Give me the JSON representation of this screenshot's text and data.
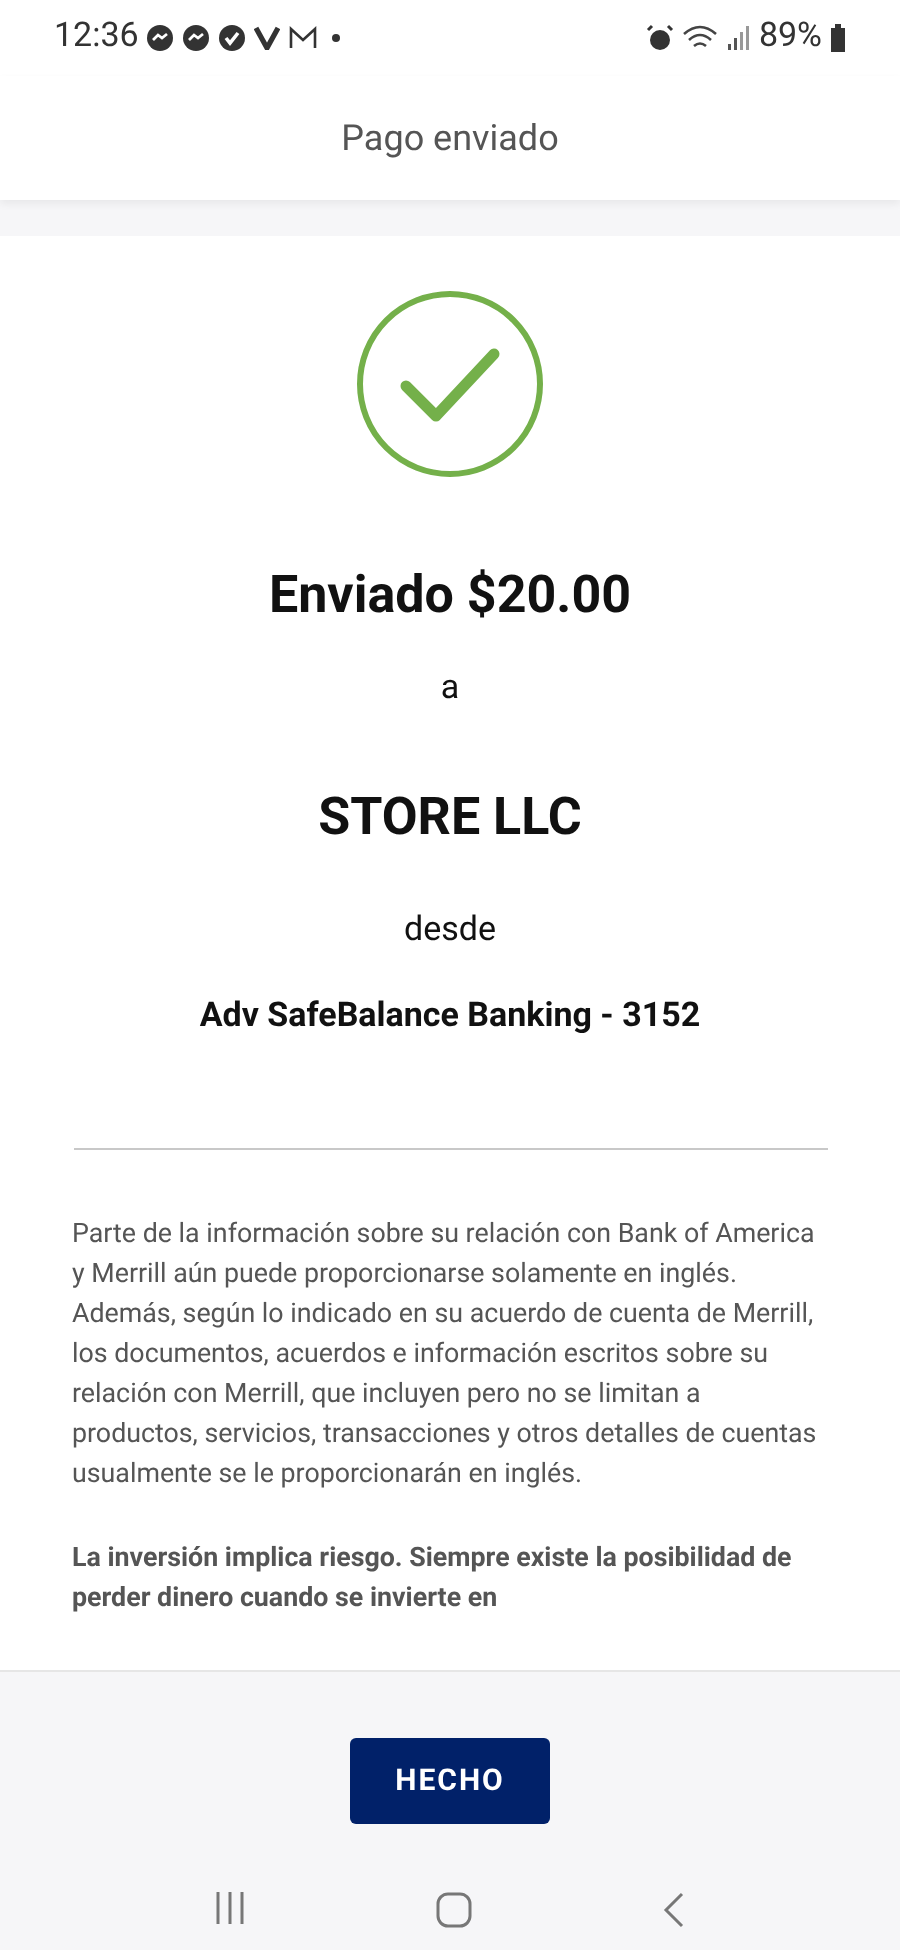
{
  "status_bar": {
    "time": "12:36",
    "battery": "89%"
  },
  "header": {
    "title": "Pago enviado"
  },
  "confirmation": {
    "amount_line": "Enviado $20.00",
    "to_word": "a",
    "recipient": "STORE LLC",
    "from_word": "desde",
    "account": "Adv SafeBalance Banking - 3152"
  },
  "disclosures": [
    {
      "kind": "normal",
      "text": "Parte de la información sobre su relación con Bank of America y Merrill aún puede proporcionarse solamente en inglés. Además, según lo indicado en su acuerdo de cuenta de Merrill, los documentos, acuerdos e información escritos sobre su relación con Merrill, que incluyen pero no se limitan a productos, servicios, transacciones y otros detalles de cuentas usualmente se le proporcionarán en inglés."
    },
    {
      "kind": "bold",
      "text": "La inversión implica riesgo. Siempre existe la posibilidad de perder dinero cuando se invierte en"
    }
  ],
  "done_button": {
    "label": "HECHO"
  }
}
